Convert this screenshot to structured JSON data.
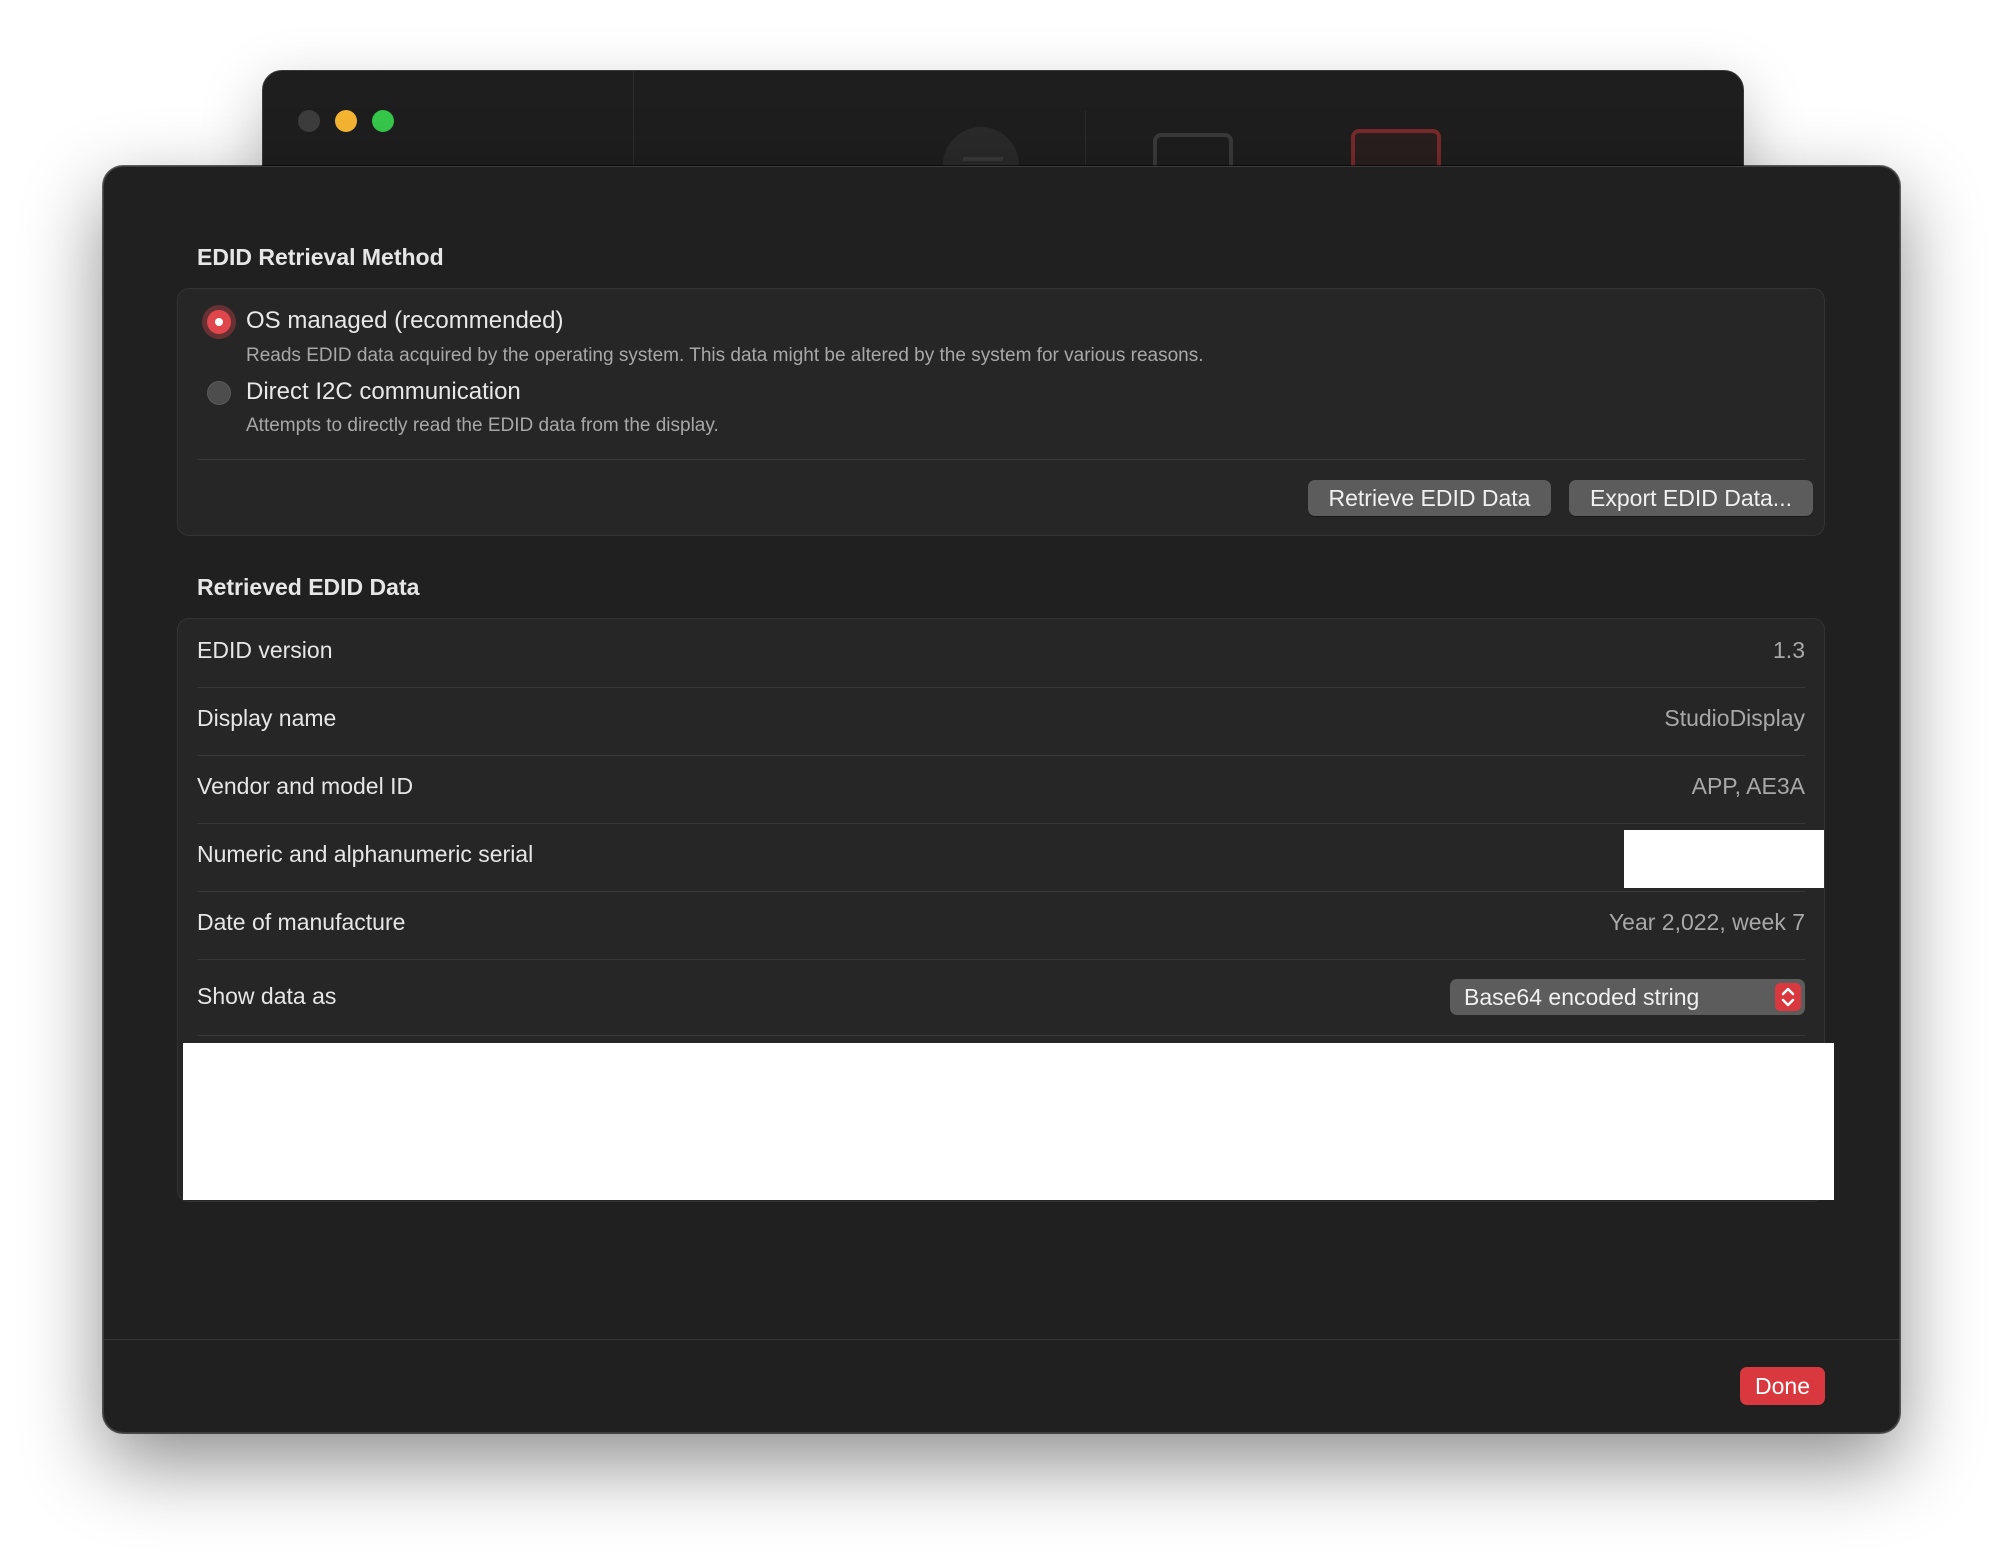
{
  "sheet": {
    "retrieval_section_title": "EDID Retrieval Method",
    "options": [
      {
        "label": "OS managed (recommended)",
        "description": "Reads EDID data acquired by the operating system. This data might be altered by the system for various reasons.",
        "selected": true
      },
      {
        "label": "Direct I2C communication",
        "description": "Attempts to directly read the EDID data from the display.",
        "selected": false
      }
    ],
    "retrieve_button": "Retrieve EDID Data",
    "export_button": "Export EDID Data...",
    "data_section_title": "Retrieved EDID Data",
    "rows": [
      {
        "label": "EDID version",
        "value": "1.3"
      },
      {
        "label": "Display name",
        "value": "StudioDisplay"
      },
      {
        "label": "Vendor and model ID",
        "value": "APP, AE3A"
      },
      {
        "label": "Numeric and alphanumeric serial",
        "value": ""
      },
      {
        "label": "Date of manufacture",
        "value": "Year 2,022, week 7"
      },
      {
        "label": "Show data as",
        "value": "Base64 encoded string"
      }
    ],
    "done_button": "Done"
  },
  "colors": {
    "accent": "#d9393e",
    "sheet_background": "#202020",
    "traffic_minimize": "#f5b532",
    "traffic_maximize": "#35c74a"
  },
  "icons": [
    "chevron-up-down-icon",
    "list-icon",
    "display-icon"
  ]
}
